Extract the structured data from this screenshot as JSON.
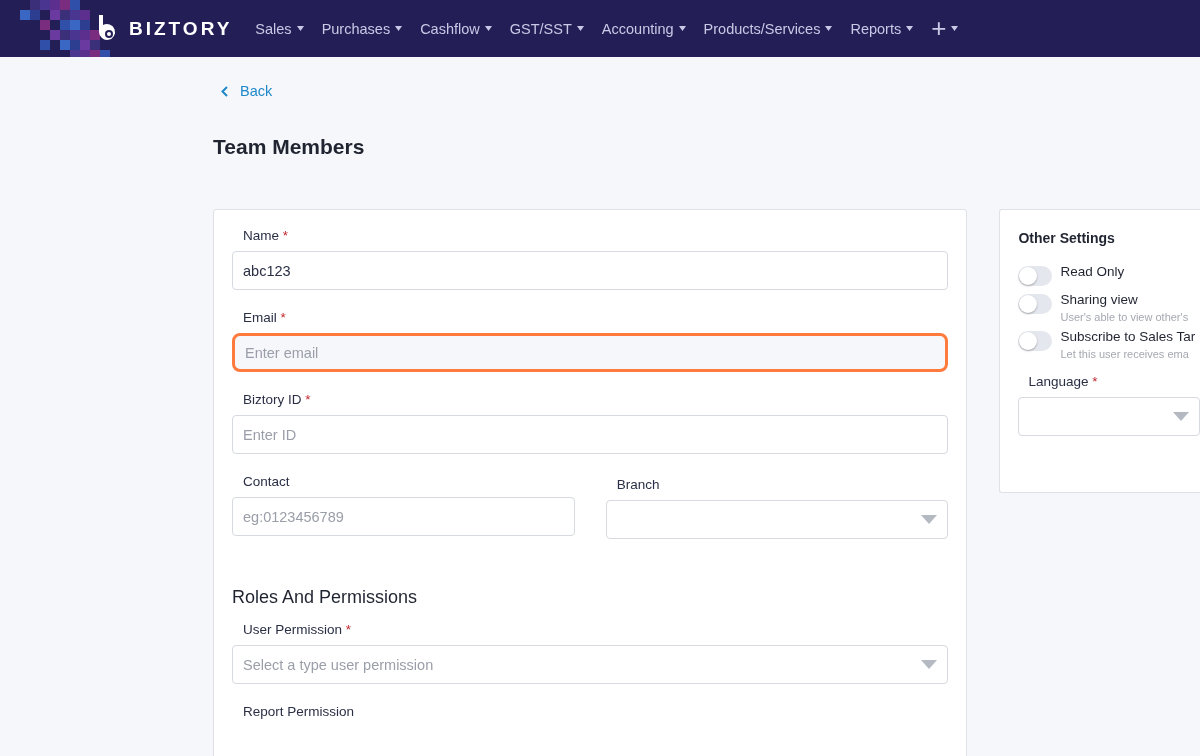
{
  "navbar": {
    "brand": "BIZTORY",
    "menu": [
      {
        "label": "Sales"
      },
      {
        "label": "Purchases"
      },
      {
        "label": "Cashflow"
      },
      {
        "label": "GST/SST"
      },
      {
        "label": "Accounting"
      },
      {
        "label": "Products/Services"
      },
      {
        "label": "Reports"
      }
    ],
    "add_label": "+"
  },
  "back_link": "Back",
  "page_title": "Team Members",
  "form": {
    "fields": [
      {
        "kind": "text",
        "label": "Name",
        "required_mark": "*",
        "value": "abc123"
      },
      {
        "kind": "text",
        "label": "Email",
        "required_mark": "*",
        "placeholder": "Enter email",
        "highlighted": true
      },
      {
        "kind": "text",
        "label": "Biztory ID",
        "required_mark": "*",
        "placeholder": "Enter ID"
      }
    ],
    "contact": {
      "kind": "text",
      "label": "Contact",
      "placeholder": "eg:0123456789"
    },
    "branch": {
      "kind": "select",
      "label": "Branch"
    },
    "section_title": "Roles And Permissions",
    "permission_fields": [
      {
        "kind": "select",
        "label": "User Permission",
        "required_mark": "*",
        "placeholder": "Select a type user permission"
      },
      {
        "kind": "none",
        "label": "Report Permission"
      }
    ]
  },
  "other_settings": {
    "title": "Other Settings",
    "toggles": [
      {
        "label": "Read Only",
        "on": false
      },
      {
        "label": "Sharing view",
        "description": "User's able to view other's",
        "on": false
      },
      {
        "label": "Subscribe to Sales Tar",
        "description": "Let this user receives ema",
        "on": false
      }
    ],
    "language": {
      "kind": "select",
      "label": "Language",
      "required_mark": "*"
    }
  }
}
